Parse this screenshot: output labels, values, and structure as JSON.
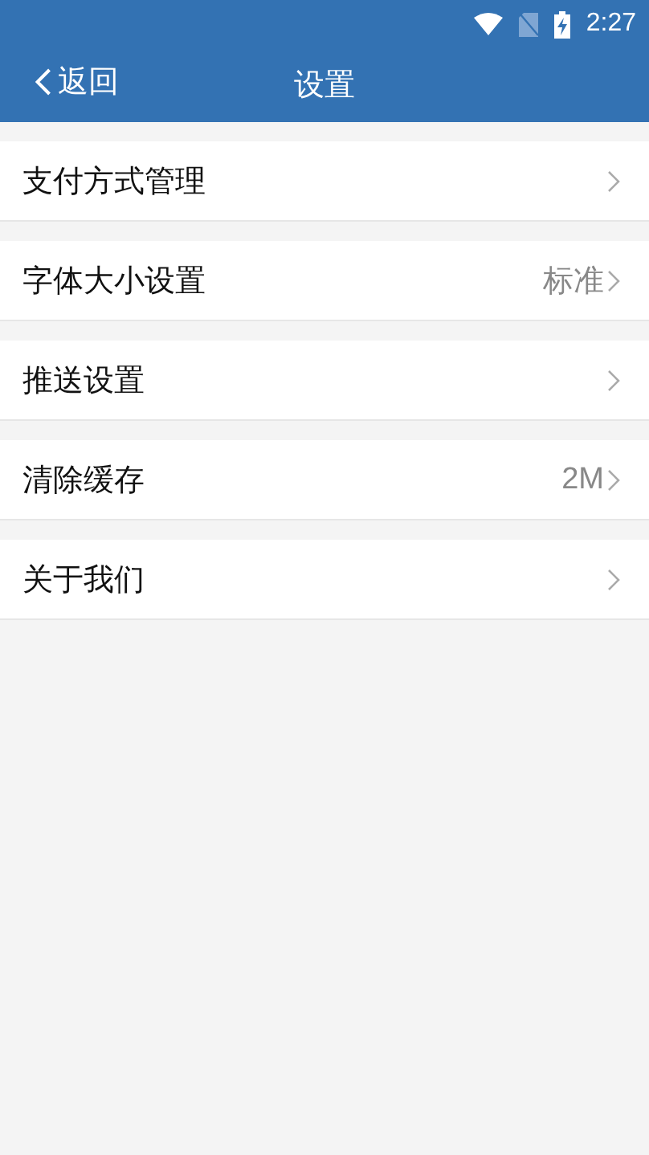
{
  "status_bar": {
    "time": "2:27"
  },
  "header": {
    "back": "返回",
    "title": "设置"
  },
  "items": [
    {
      "label": "支付方式管理"
    },
    {
      "label": "字体大小设置",
      "value": "标准"
    },
    {
      "label": "推送设置"
    },
    {
      "label": "清除缓存",
      "value": "2M"
    },
    {
      "label": "关于我们"
    }
  ]
}
